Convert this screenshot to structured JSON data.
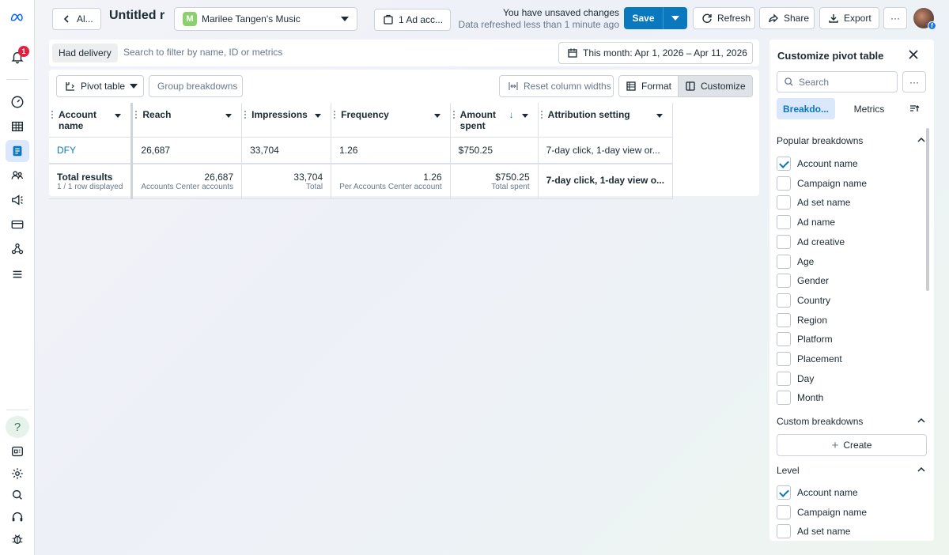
{
  "sidebar": {
    "notification_count": "1",
    "help_label": "?"
  },
  "header": {
    "back_label": "Al...",
    "report_title": "Untitled r",
    "account_initial": "M",
    "account_name": "Marilee Tangen's Music",
    "ad_accounts_label": "1 Ad acc...",
    "unsaved_text": "You have unsaved changes",
    "refreshed_text": "Data refreshed less than 1 minute ago",
    "save_label": "Save",
    "refresh_label": "Refresh",
    "share_label": "Share",
    "export_label": "Export",
    "more_label": "···"
  },
  "filters": {
    "chip": "Had delivery",
    "placeholder": "Search to filter by name, ID or metrics",
    "date_range": "This month: Apr 1, 2026 – Apr 11, 2026"
  },
  "toolbar": {
    "view_label": "Pivot table",
    "group_label": "Group breakdowns",
    "reset_label": "Reset column widths",
    "format_label": "Format",
    "customize_label": "Customize"
  },
  "table": {
    "columns": [
      {
        "label": "Account name"
      },
      {
        "label": "Reach"
      },
      {
        "label": "Impressions"
      },
      {
        "label": "Frequency"
      },
      {
        "label": "Amount spent",
        "sort": "↓"
      },
      {
        "label": "Attribution setting"
      }
    ],
    "rows": [
      {
        "account": "DFY",
        "reach": "26,687",
        "impressions": "33,704",
        "frequency": "1.26",
        "amount": "$750.25",
        "attribution": "7-day click, 1-day view or..."
      }
    ],
    "totals": {
      "label": "Total results",
      "sublabel": "1 / 1 row displayed",
      "reach": "26,687",
      "reach_sub": "Accounts Center accounts",
      "impressions": "33,704",
      "impressions_sub": "Total",
      "frequency": "1.26",
      "frequency_sub": "Per Accounts Center account",
      "amount": "$750.25",
      "amount_sub": "Total spent",
      "attribution": "7-day click, 1-day view o..."
    }
  },
  "customize_panel": {
    "title": "Customize pivot table",
    "search_placeholder": "Search",
    "more_label": "···",
    "tab_breakdowns": "Breakdo...",
    "tab_metrics": "Metrics",
    "popular_title": "Popular breakdowns",
    "popular": [
      {
        "label": "Account name",
        "checked": true
      },
      {
        "label": "Campaign name",
        "checked": false
      },
      {
        "label": "Ad set name",
        "checked": false
      },
      {
        "label": "Ad name",
        "checked": false
      },
      {
        "label": "Ad creative",
        "checked": false
      },
      {
        "label": "Age",
        "checked": false
      },
      {
        "label": "Gender",
        "checked": false
      },
      {
        "label": "Country",
        "checked": false
      },
      {
        "label": "Region",
        "checked": false
      },
      {
        "label": "Platform",
        "checked": false
      },
      {
        "label": "Placement",
        "checked": false
      },
      {
        "label": "Day",
        "checked": false
      },
      {
        "label": "Month",
        "checked": false
      }
    ],
    "custom_title": "Custom breakdowns",
    "create_label": "Create",
    "level_title": "Level",
    "level": [
      {
        "label": "Account name",
        "checked": true
      },
      {
        "label": "Campaign name",
        "checked": false
      },
      {
        "label": "Ad set name",
        "checked": false
      }
    ]
  },
  "colors": {
    "accent": "#0a78be",
    "badge": "#e41e3f",
    "selected_bg": "#dbe7fb"
  }
}
